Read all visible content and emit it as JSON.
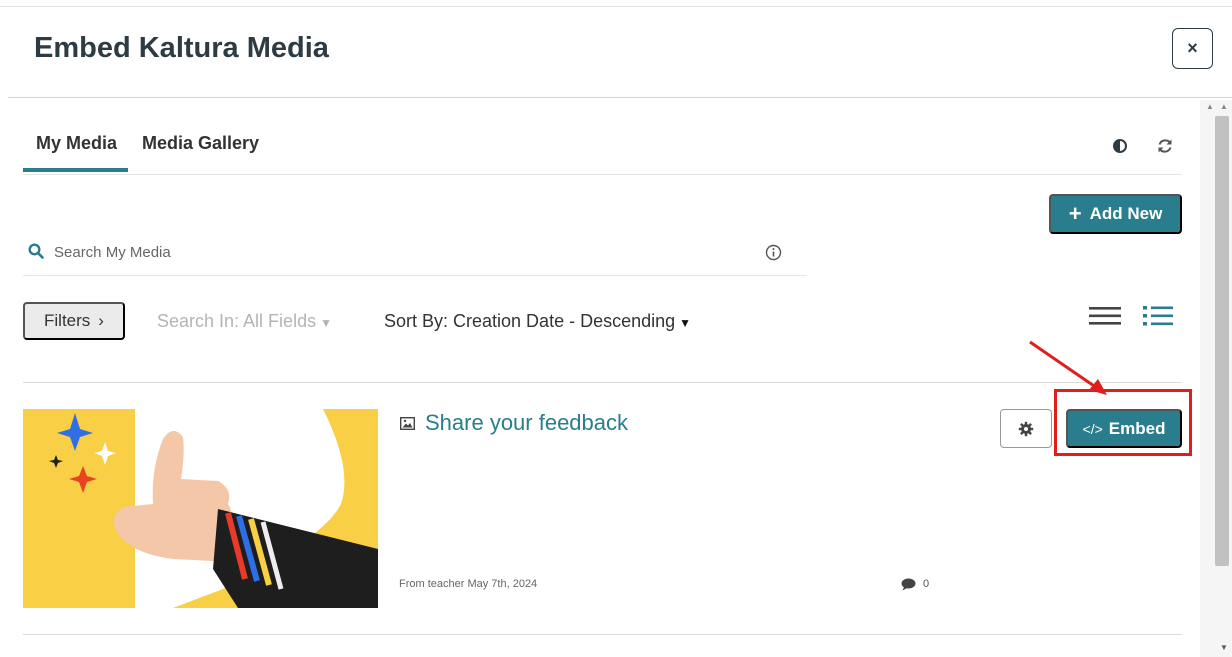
{
  "dialog": {
    "title": "Embed Kaltura Media",
    "close_label": "×"
  },
  "tabs": [
    {
      "label": "My Media",
      "active": true
    },
    {
      "label": "Media Gallery",
      "active": false
    }
  ],
  "toolbar": {
    "add_new_label": "Add New",
    "add_new_icon": "plus-icon",
    "contrast_icon": "contrast-icon",
    "refresh_icon": "refresh-icon"
  },
  "search": {
    "placeholder": "Search My Media",
    "value": "",
    "info_icon": "info-icon"
  },
  "filter_bar": {
    "filters_label": "Filters",
    "filters_chevron": "›",
    "search_in_label": "Search In: All Fields",
    "sort_by_label": "Sort By: Creation Date - Descending"
  },
  "media_items": [
    {
      "title": "Share your feedback",
      "type_icon": "image-icon",
      "meta": "From teacher May 7th, 2024",
      "comment_count": "0",
      "embed_label": "Embed",
      "embed_code_glyph": "</>"
    }
  ],
  "colors": {
    "accent": "#2a7d8c",
    "highlight": "#e01e1e",
    "thumbnail_bg": "#f8cf45"
  }
}
